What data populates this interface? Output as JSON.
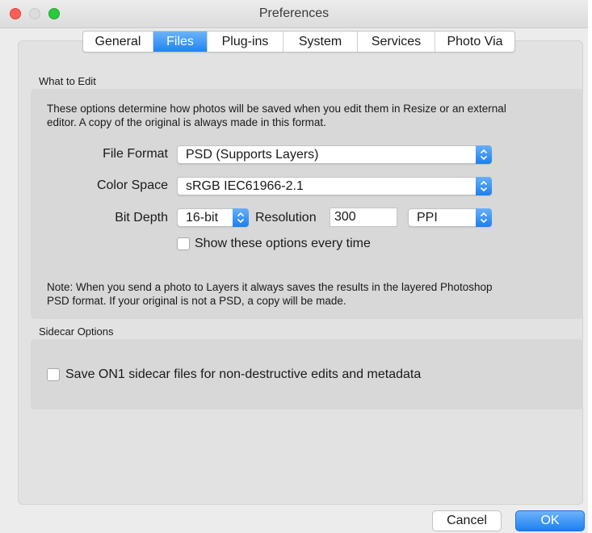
{
  "window": {
    "title": "Preferences"
  },
  "tabs": [
    {
      "label": "General",
      "active": false
    },
    {
      "label": "Files",
      "active": true
    },
    {
      "label": "Plug-ins",
      "active": false
    },
    {
      "label": "System",
      "active": false
    },
    {
      "label": "Services",
      "active": false
    },
    {
      "label": "Photo Via",
      "active": false
    }
  ],
  "what_to_edit": {
    "heading": "What to Edit",
    "description_line1": "These options determine how photos will be saved when you edit them in Resize or an external",
    "description_line2": "editor.  A copy of the original is always made in this format.",
    "file_format_label": "File Format",
    "file_format_value": "PSD (Supports Layers)",
    "color_space_label": "Color Space",
    "color_space_value": "sRGB IEC61966-2.1",
    "bit_depth_label": "Bit Depth",
    "bit_depth_value": "16-bit",
    "resolution_label": "Resolution",
    "resolution_value": "300",
    "resolution_unit": "PPI",
    "show_options_label": "Show these options every time",
    "show_options_checked": false,
    "note_line1": "Note: When you send a photo to Layers it always saves the results in the layered Photoshop",
    "note_line2": "PSD format.  If your original is not a PSD, a copy will be made."
  },
  "sidecar": {
    "heading": "Sidecar Options",
    "save_sidecar_label": "Save ON1 sidecar files for non-destructive edits and metadata",
    "save_sidecar_checked": false
  },
  "buttons": {
    "cancel": "Cancel",
    "ok": "OK"
  },
  "colors": {
    "accent": "#1f84f3",
    "window_bg": "#ececec",
    "group_bg": "#d8d8d8"
  }
}
